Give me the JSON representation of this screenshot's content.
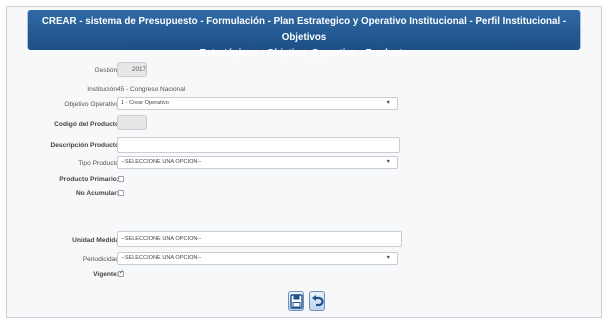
{
  "header": {
    "title_line1": "CREAR - sistema de Presupuesto - Formulación - Plan Estrategico y Operativo Institucional - Perfil Institucional - Objetivos",
    "title_line2": "Estratégicos - Objetivo_Operativo - Producto"
  },
  "form": {
    "gestion": {
      "label": "Gestión:",
      "value": "2017"
    },
    "institucion": {
      "label": "Institución",
      "value": "45 - Congreso Nacional"
    },
    "objetivo_operativo": {
      "label": "Objetivo Operativo",
      "value": "1 - Crear Operativo"
    },
    "codigo_producto": {
      "label": "Codigó del Producto",
      "value": ""
    },
    "descripcion_producto": {
      "label": "Descripción Producto",
      "value": ""
    },
    "tipo_producto": {
      "label": "Tipo Producto",
      "value": "--SELECCIONE UNA OPCION--"
    },
    "producto_primario": {
      "label": "Producto Primario:",
      "checked": false
    },
    "no_acumular": {
      "label": "No Acumular:",
      "checked": false
    },
    "unidad_medida": {
      "label": "Unidad Medida",
      "value": "--SELECCIONE UNA OPCION--"
    },
    "periodicidad": {
      "label": "Periodicidad",
      "value": "--SELECCIONE UNA OPCION--"
    },
    "vigente": {
      "label": "Vigente:",
      "checked": true
    }
  },
  "actions": {
    "save_icon": "save-icon",
    "back_icon": "undo-icon"
  },
  "colors": {
    "header_top": "#2f6aa6",
    "header_bottom": "#1d4f86",
    "page_bg": "#f7f8fa"
  }
}
